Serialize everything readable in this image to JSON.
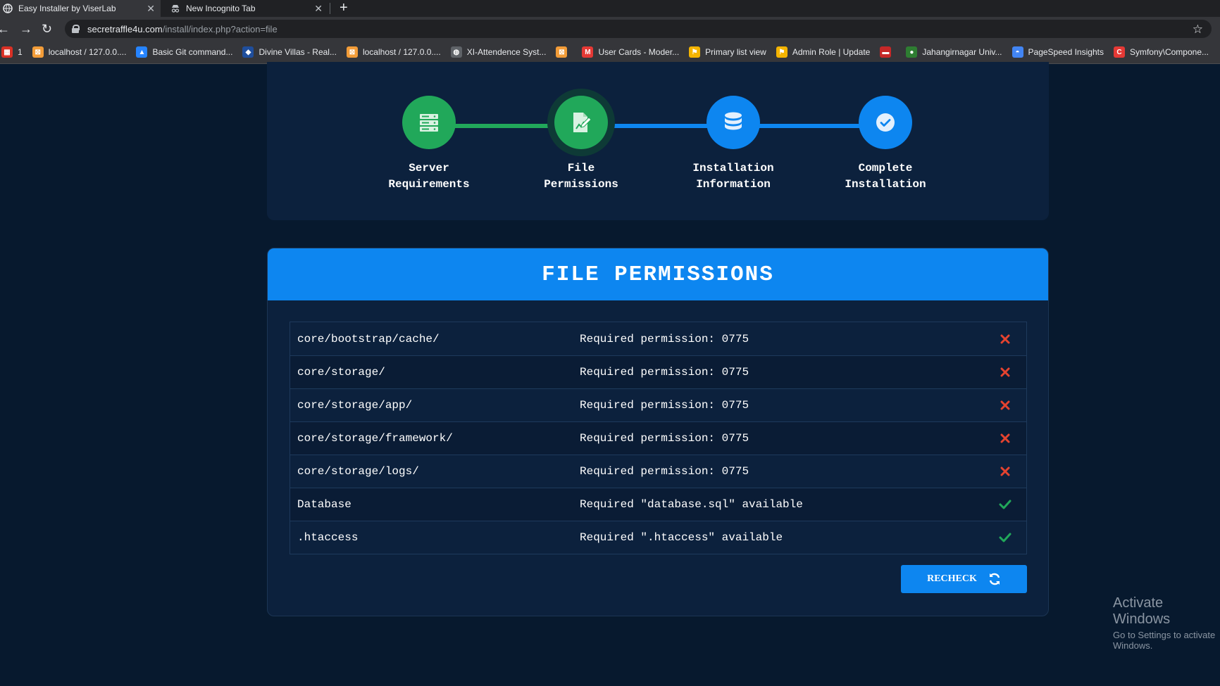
{
  "browser": {
    "tabs": [
      {
        "label": "Easy Installer by ViserLab",
        "active": true
      },
      {
        "label": "New Incognito Tab",
        "active": false
      }
    ],
    "url_host": "secretraffle4u.com",
    "url_path": "/install/index.php?action=file",
    "bookmarks": [
      {
        "label": "1",
        "icon": "calendar-icon",
        "color": "#d93025"
      },
      {
        "label": "localhost / 127.0.0....",
        "icon": "phpmyadmin-icon",
        "color": "#f29c38"
      },
      {
        "label": "Basic Git command...",
        "icon": "atlassian-icon",
        "color": "#2684ff"
      },
      {
        "label": "Divine Villas - Real...",
        "icon": "site-icon",
        "color": "#1f4e9c"
      },
      {
        "label": "localhost / 127.0.0....",
        "icon": "phpmyadmin-icon",
        "color": "#f29c38"
      },
      {
        "label": "XI-Attendence Syst...",
        "icon": "globe-icon",
        "color": "#5f6368"
      },
      {
        "label": "",
        "icon": "phpmyadmin-icon",
        "color": "#f29c38"
      },
      {
        "label": "User Cards - Moder...",
        "icon": "user-cards-icon",
        "color": "#e53935"
      },
      {
        "label": "Primary list view",
        "icon": "flag-icon",
        "color": "#f4b400"
      },
      {
        "label": "Admin Role | Update",
        "icon": "flag-icon",
        "color": "#f4b400"
      },
      {
        "label": "",
        "icon": "window-icon",
        "color": "#c62828"
      },
      {
        "label": "Jahangirnagar Univ...",
        "icon": "university-icon",
        "color": "#2e7d32"
      },
      {
        "label": "PageSpeed Insights",
        "icon": "pagespeed-icon",
        "color": "#4285f4"
      },
      {
        "label": "Symfony\\Compone...",
        "icon": "symfony-icon",
        "color": "#e53935"
      }
    ]
  },
  "steps": [
    {
      "line1": "Server",
      "line2": "Requirements",
      "color": "#21a85a",
      "icon": "server-icon",
      "state": "done"
    },
    {
      "line1": "File",
      "line2": "Permissions",
      "color": "#21a85a",
      "icon": "file-edit-icon",
      "state": "current"
    },
    {
      "line1": "Installation",
      "line2": "Information",
      "color": "#0d86f0",
      "icon": "database-icon",
      "state": "pending"
    },
    {
      "line1": "Complete",
      "line2": "Installation",
      "color": "#0d86f0",
      "icon": "check-circle-icon",
      "state": "pending"
    }
  ],
  "panel": {
    "title": "FILE PERMISSIONS",
    "rows": [
      {
        "path": "core/bootstrap/cache/",
        "requirement": "Required permission: 0775",
        "status": "fail"
      },
      {
        "path": "core/storage/",
        "requirement": "Required permission: 0775",
        "status": "fail"
      },
      {
        "path": "core/storage/app/",
        "requirement": "Required permission: 0775",
        "status": "fail"
      },
      {
        "path": "core/storage/framework/",
        "requirement": "Required permission: 0775",
        "status": "fail"
      },
      {
        "path": "core/storage/logs/",
        "requirement": "Required permission: 0775",
        "status": "fail"
      },
      {
        "path": "Database",
        "requirement": "Required \"database.sql\" available",
        "status": "pass"
      },
      {
        "path": ".htaccess",
        "requirement": "Required \".htaccess\" available",
        "status": "pass"
      }
    ],
    "recheck_label": "RECHECK",
    "fail_color": "#e5432f",
    "pass_color": "#21a85a"
  },
  "watermark": {
    "title": "Activate Windows",
    "subtitle": "Go to Settings to activate Windows."
  }
}
